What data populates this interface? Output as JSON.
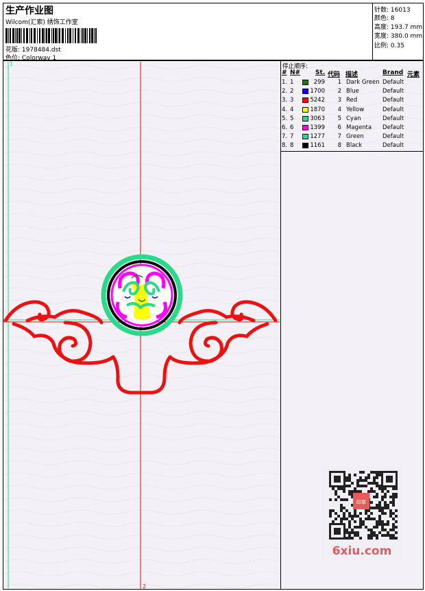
{
  "header": {
    "title": "生产作业图",
    "company": "Wilcom(汇索) 绣饰工作室",
    "design_label": "花版:",
    "design_value": "1978484.dst",
    "colorway_label": "色位:",
    "colorway_value": "Colorway 1"
  },
  "stats": {
    "stitches_label": "针数:",
    "stitches_value": "16013",
    "colors_label": "颜色:",
    "colors_value": "8",
    "height_label": "高度:",
    "height_value": "193.7 mm",
    "width_label": "宽度:",
    "width_value": "380.0 mm",
    "scale_label": "比例:",
    "scale_value": "0.35"
  },
  "stop_panel": {
    "title": "停止顺序:",
    "headers": {
      "hash": "#",
      "n": "N#",
      "st": "St.",
      "code": "代码",
      "desc": "描述",
      "brand": "Brand",
      "elem": "元素"
    },
    "rows": [
      {
        "idx": "1.",
        "n": "1",
        "color": "#1a7a1a",
        "st": "299",
        "code": "1",
        "desc": "Dark Green",
        "brand": "Default"
      },
      {
        "idx": "2.",
        "n": "2",
        "color": "#0000ff",
        "st": "1700",
        "code": "2",
        "desc": "Blue",
        "brand": "Default"
      },
      {
        "idx": "3.",
        "n": "3",
        "color": "#ff0000",
        "st": "5242",
        "code": "3",
        "desc": "Red",
        "brand": "Default"
      },
      {
        "idx": "4.",
        "n": "4",
        "color": "#ffff00",
        "st": "1870",
        "code": "4",
        "desc": "Yellow",
        "brand": "Default"
      },
      {
        "idx": "5.",
        "n": "5",
        "color": "#2ad98a",
        "st": "3063",
        "code": "5",
        "desc": "Cyan",
        "brand": "Default"
      },
      {
        "idx": "6.",
        "n": "6",
        "color": "#ff00ff",
        "st": "1399",
        "code": "6",
        "desc": "Magenta",
        "brand": "Default"
      },
      {
        "idx": "7.",
        "n": "7",
        "color": "#2ad98a",
        "st": "1277",
        "code": "7",
        "desc": "Green",
        "brand": "Default"
      },
      {
        "idx": "8.",
        "n": "8",
        "color": "#000000",
        "st": "1161",
        "code": "8",
        "desc": "Black",
        "brand": "Default"
      }
    ]
  },
  "canvas": {
    "guide_label_1": "1",
    "guide_label_2": "2",
    "watermark": "6xiu.com",
    "stamp_text": "印章"
  }
}
